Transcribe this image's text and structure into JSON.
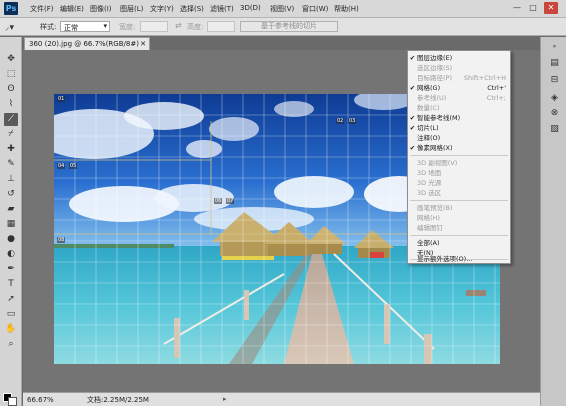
{
  "app": {
    "logo": "Ps"
  },
  "menubar": {
    "items": [
      "文件(F)",
      "编辑(E)",
      "图像(I)",
      "图层(L)",
      "文字(Y)",
      "选择(S)",
      "滤镜(T)",
      "3D(D)",
      "视图(V)",
      "窗口(W)",
      "帮助(H)"
    ],
    "window_buttons": [
      "—",
      "□",
      "✕"
    ]
  },
  "options_bar": {
    "style_label": "样式:",
    "style_value": "正常",
    "width_label": "宽度:",
    "height_label": "高度:",
    "slice_button": "基于参考线的切片"
  },
  "document": {
    "tab_title": "360 (20).jpg @ 66.7%(RGB/8#)",
    "tab_close": "✕",
    "zoom": "66.67%",
    "doc_size": "文档:2.25M/2.25M"
  },
  "slice_labels": [
    "01",
    "02",
    "03",
    "04",
    "05",
    "06",
    "07",
    "08"
  ],
  "context_menu": {
    "items": [
      {
        "label": "图层边缘(E)",
        "shortcut": "",
        "checked": true,
        "enabled": true
      },
      {
        "label": "选区边缘(S)",
        "shortcut": "",
        "checked": false,
        "enabled": false
      },
      {
        "label": "目标路径(P)",
        "shortcut": "Shift+Ctrl+H",
        "checked": false,
        "enabled": false
      },
      {
        "label": "网格(G)",
        "shortcut": "Ctrl+'",
        "checked": true,
        "enabled": true
      },
      {
        "label": "参考线(U)",
        "shortcut": "Ctrl+;",
        "checked": false,
        "enabled": false
      },
      {
        "label": "数量(C)",
        "shortcut": "",
        "checked": false,
        "enabled": false
      },
      {
        "label": "智能参考线(M)",
        "shortcut": "",
        "checked": true,
        "enabled": true
      },
      {
        "label": "切片(L)",
        "shortcut": "",
        "checked": true,
        "enabled": true
      },
      {
        "label": "注释(O)",
        "shortcut": "",
        "checked": false,
        "enabled": true
      },
      {
        "label": "像素网格(X)",
        "shortcut": "",
        "checked": true,
        "enabled": true
      },
      {
        "label": "3D 副视图(V)",
        "shortcut": "",
        "checked": false,
        "enabled": false
      },
      {
        "label": "3D 地面",
        "shortcut": "",
        "checked": false,
        "enabled": false
      },
      {
        "label": "3D 光源",
        "shortcut": "",
        "checked": false,
        "enabled": false
      },
      {
        "label": "3D 选区",
        "shortcut": "",
        "checked": false,
        "enabled": false
      },
      {
        "label": "画笔预览(B)",
        "shortcut": "",
        "checked": false,
        "enabled": false
      },
      {
        "label": "网格(H)",
        "shortcut": "",
        "checked": false,
        "enabled": false
      },
      {
        "label": "编辑图钉",
        "shortcut": "",
        "checked": false,
        "enabled": false
      },
      {
        "label": "全部(A)",
        "shortcut": "",
        "checked": false,
        "enabled": true
      },
      {
        "label": "无(N)",
        "shortcut": "",
        "checked": false,
        "enabled": true
      },
      {
        "label": "显示额外选项(O)...",
        "shortcut": "",
        "checked": false,
        "enabled": true
      }
    ],
    "check_mark": "✔"
  },
  "colors": {
    "menu_bg": "#f2f2f2",
    "disabled_text": "#9b9b9b",
    "canvas_bg": "#747474",
    "sky": "#1d4fa8",
    "water": "#3fb6cf"
  },
  "icons": {
    "toolbar": [
      "move-icon",
      "marquee-icon",
      "lasso-icon",
      "quick-select-icon",
      "crop-icon",
      "eyedropper-icon",
      "healing-icon",
      "brush-icon",
      "clone-stamp-icon",
      "history-brush-icon",
      "eraser-icon",
      "gradient-icon",
      "blur-icon",
      "dodge-icon",
      "pen-icon",
      "type-icon",
      "path-select-icon",
      "shape-icon",
      "hand-icon",
      "zoom-icon",
      "quick-mask-icon",
      "screen-mode-icon"
    ],
    "dock": [
      "history-icon",
      "properties-icon",
      "layers-icon",
      "channels-icon",
      "paths-icon"
    ]
  }
}
